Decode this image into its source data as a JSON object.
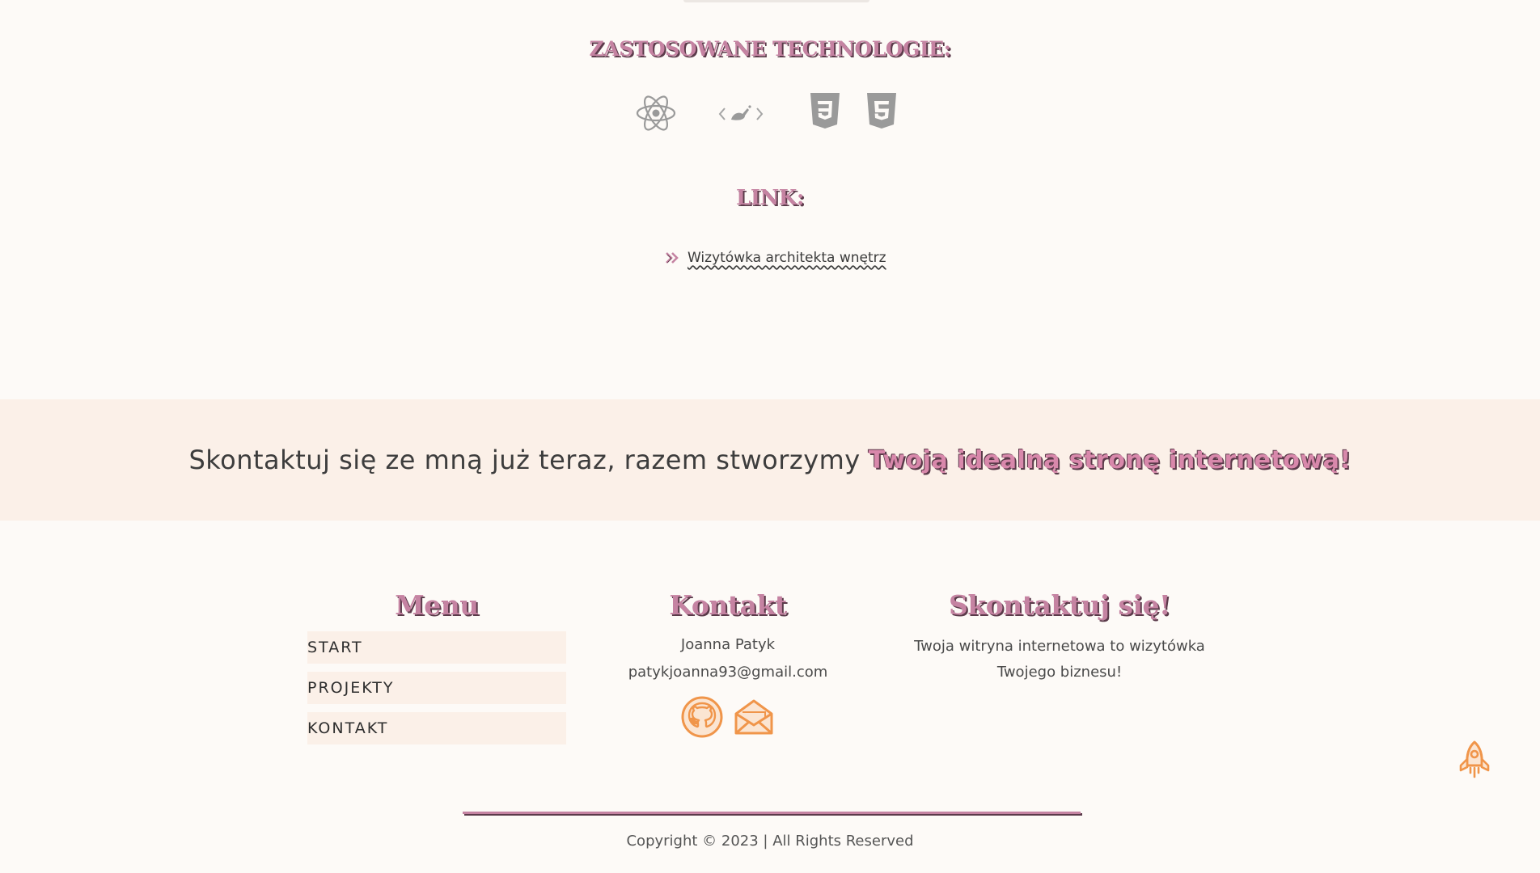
{
  "technologies": {
    "title": "ZASTOSOWANE TECHNOLOGIE:",
    "icons": [
      "react-icon",
      "styled-components-icon",
      "css3-icon",
      "html5-icon"
    ]
  },
  "links": {
    "title": "LINK:",
    "items": [
      {
        "label": "Wizytówka architekta wnętrz"
      }
    ]
  },
  "cta": {
    "text": "Skontaktuj się ze mną już teraz, razem stworzymy",
    "accent": "Twoją idealną stronę internetową!"
  },
  "footer": {
    "menu": {
      "title": "Menu",
      "items": [
        {
          "label": "START"
        },
        {
          "label": "PROJEKTY"
        },
        {
          "label": "KONTAKT"
        }
      ]
    },
    "contact": {
      "title": "Kontakt",
      "name": "Joanna Patyk",
      "email": "patykjoanna93@gmail.com",
      "icons": [
        "github-icon",
        "mail-icon"
      ]
    },
    "reach_out": {
      "title": "Skontaktuj się!",
      "line1": "Twoja witryna internetowa to wizytówka",
      "line2": "Twojego biznesu!"
    },
    "copyright": "Copyright © 2023 | All Rights Reserved"
  },
  "colors": {
    "accent_pink": "#c583a2",
    "accent_orange": "#f0954a",
    "band_bg": "#fbf0e8",
    "page_bg": "#fdfaf7"
  }
}
